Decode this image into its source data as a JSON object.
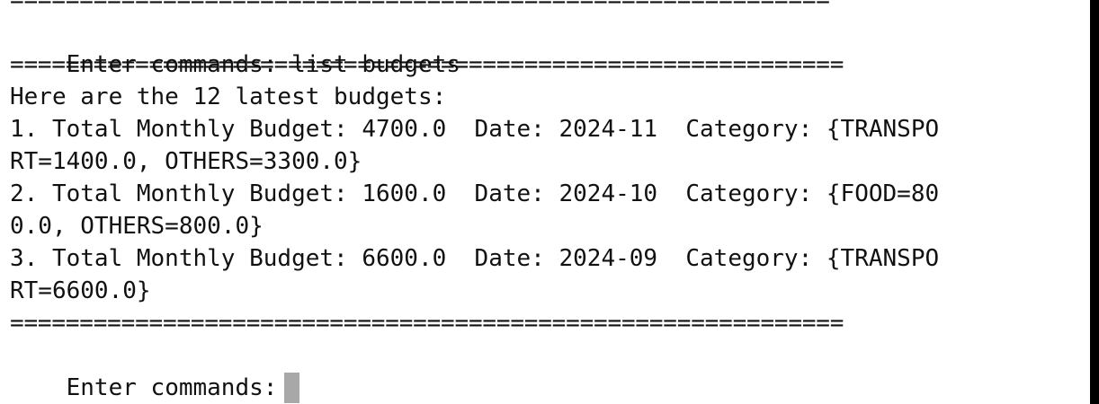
{
  "terminal": {
    "separator_top": "===========================================================",
    "command_line": {
      "prompt": "Enter commands:",
      "input": " list budgets"
    },
    "separator_after_command": "============================================================",
    "header": "Here are the 12 latest budgets:",
    "budget_lines": [
      "1. Total Monthly Budget: 4700.0  Date: 2024-11  Category: {TRANSPO",
      "RT=1400.0, OTHERS=3300.0}",
      "2. Total Monthly Budget: 1600.0  Date: 2024-10  Category: {FOOD=80",
      "0.0, OTHERS=800.0}",
      "3. Total Monthly Budget: 6600.0  Date: 2024-09  Category: {TRANSPO",
      "RT=6600.0}"
    ],
    "separator_bottom": "============================================================",
    "final_prompt": "Enter commands:",
    "colors": {
      "background": "#ffffff",
      "text": "#111111",
      "cursor": "#a8a8a8",
      "right_edge": "#000000"
    }
  }
}
